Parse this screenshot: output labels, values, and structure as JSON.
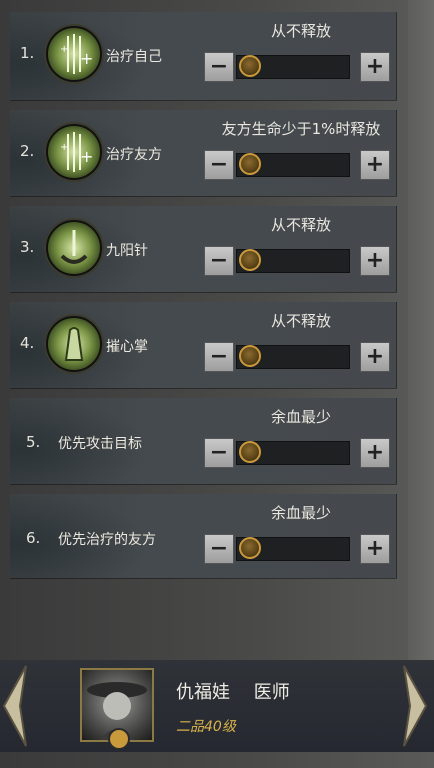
{
  "rows": [
    {
      "num": "1.",
      "name": "治疗自己",
      "setting": "从不释放",
      "icon": "heal-self-icon"
    },
    {
      "num": "2.",
      "name": "治疗友方",
      "setting": "友方生命少于1%时释放",
      "icon": "heal-ally-icon"
    },
    {
      "num": "3.",
      "name": "九阳针",
      "setting": "从不释放",
      "icon": "needle-icon"
    },
    {
      "num": "4.",
      "name": "摧心掌",
      "setting": "从不释放",
      "icon": "palm-icon"
    },
    {
      "num": "5.",
      "name": "优先攻击目标",
      "setting": "余血最少",
      "icon": ""
    },
    {
      "num": "6.",
      "name": "优先治疗的友方",
      "setting": "余血最少",
      "icon": ""
    }
  ],
  "controls": {
    "minus": "−",
    "plus": "+"
  },
  "character": {
    "name": "仇福娃",
    "role": "医师",
    "rank": "二品40级"
  },
  "colors": {
    "accent": "#c89a3c",
    "panel": "#454a4e",
    "rank": "#d8b24a"
  }
}
